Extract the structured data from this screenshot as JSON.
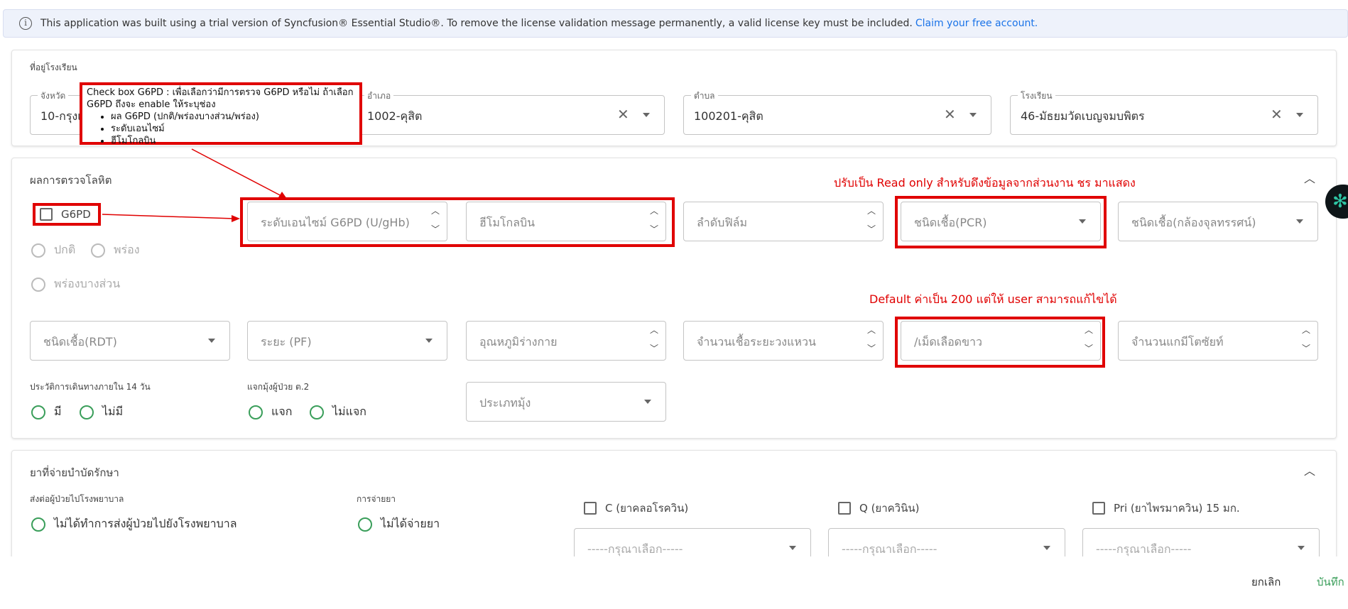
{
  "banner": {
    "text": "This application was built using a trial version of Syncfusion® Essential Studio®. To remove the license validation message permanently, a valid license key must be included.",
    "link": "Claim your free account."
  },
  "address": {
    "title": "ที่อยู่โรงเรียน",
    "province": {
      "label": "จังหวัด",
      "value": "10-กรุงเ"
    },
    "district": {
      "label": "อำเภอ",
      "value": "1002-คุสิต"
    },
    "subdistrict": {
      "label": "ตำบล",
      "value": "100201-คุสิต"
    },
    "school": {
      "label": "โรงเรียน",
      "value": "46-มัธยมวัดเบญจมบพิตร"
    }
  },
  "annotations": {
    "note_title": "Check box G6PD : เพื่อเลือกว่ามีการตรวจ G6PD หรือไม่ ถ้าเลือก G6PD ถึงจะ enable ให้ระบุช่อง",
    "note_items": [
      "ผล G6PD (ปกติ/พร่องบางส่วน/พร่อง)",
      "ระดับเอนไซม์",
      "ฮีโมโกลบิน"
    ],
    "readonly_note": "ปรับเป็น Read only สำหรับดึงข้อมูลจากส่วนงาน ชร มาแสดง",
    "default_note": "Default ค่าเป็น 200 แต่ให้ user สามารถแก้ไขได้"
  },
  "blood": {
    "title": "ผลการตรวจโลหิต",
    "g6pd_label": "G6PD",
    "radios": [
      "ปกติ",
      "พร่อง",
      "พร่องบางส่วน"
    ],
    "enzyme_ph": "ระดับเอนไซม์ G6PD (U/gHb)",
    "hemoglobin_ph": "ฮีโมโกลบิน",
    "film_ph": "ลำดับฟิล์ม",
    "pcr_ph": "ชนิดเชื้อ(PCR)",
    "micro_ph": "ชนิดเชื้อ(กล้องจุลทรรศน์)",
    "rdt_ph": "ชนิดเชื้อ(RDT)",
    "stage_ph": "ระยะ (PF)",
    "temp_ph": "อุณหภูมิร่างกาย",
    "ring_ph": "จำนวนเชื้อระยะวงแหวน",
    "wbc_ph": "/เม็ดเลือดขาว",
    "gameto_ph": "จำนวนแกมีโตซัยท์",
    "travel_label": "ประวัติการเดินทางภายใน 14 วัน",
    "travel_opts": [
      "มี",
      "ไม่มี"
    ],
    "net_label": "แจกมุ้งผู้ป่วย ต.2",
    "net_opts": [
      "แจก",
      "ไม่แจก"
    ],
    "net_type_ph": "ประเภทมุ้ง"
  },
  "drugs": {
    "title": "ยาที่จ่ายบำบัดรักษา",
    "refer_label": "ส่งต่อผู้ป่วยไปโรงพยาบาล",
    "refer_opt1": "ไม่ได้ทำการส่งผู้ป่วยไปยังโรงพยาบาล",
    "dispense_label": "การจ่ายยา",
    "dispense_opt1": "ไม่ได้จ่ายยา",
    "c_label": "C (ยาคลอโรควิน)",
    "q_label": "Q (ยาควินิน)",
    "pri_label": "Pri (ยาไพรมาควิน) 15 มก.",
    "select_ph": "-----กรุณาเลือก-----"
  },
  "footer": {
    "cancel": "ยกเลิก",
    "save": "บันทึก"
  },
  "colors": {
    "accent_green": "#3a9e5a",
    "annotation_red": "#e00000",
    "link_blue": "#1a73e8"
  }
}
